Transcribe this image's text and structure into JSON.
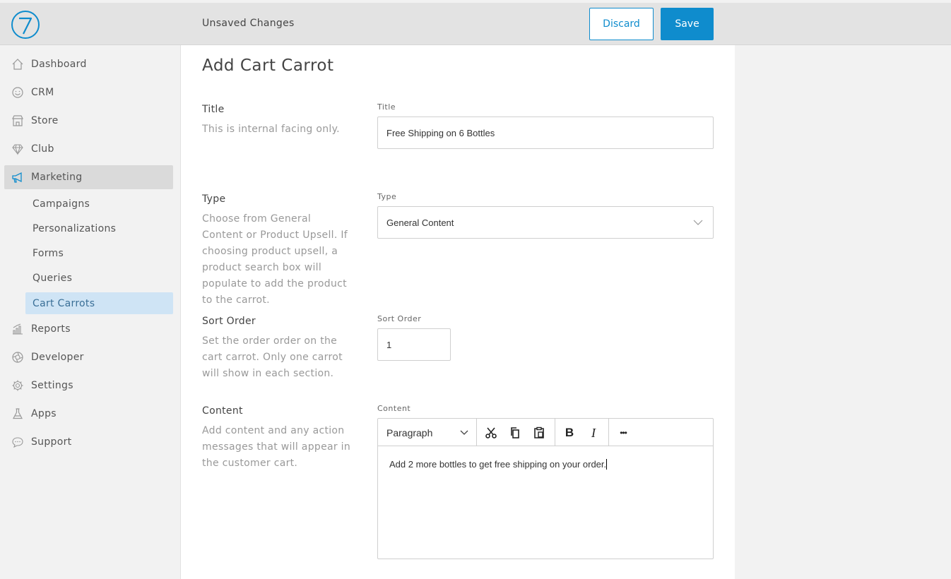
{
  "header": {
    "status_text": "Unsaved Changes",
    "discard_label": "Discard",
    "save_label": "Save",
    "logo_glyph": "7"
  },
  "colors": {
    "accent": "#0f8ccd",
    "active_nav_bg": "#dadada",
    "active_sub_bg": "#cfe4f5"
  },
  "sidebar": {
    "items": [
      {
        "label": "Dashboard",
        "icon": "home-icon"
      },
      {
        "label": "CRM",
        "icon": "smiley-icon"
      },
      {
        "label": "Store",
        "icon": "storefront-icon"
      },
      {
        "label": "Club",
        "icon": "diamond-icon"
      },
      {
        "label": "Marketing",
        "icon": "megaphone-icon",
        "active": true
      },
      {
        "label": "Reports",
        "icon": "bar-chart-icon"
      },
      {
        "label": "Developer",
        "icon": "aperture-icon"
      },
      {
        "label": "Settings",
        "icon": "gear-icon"
      },
      {
        "label": "Apps",
        "icon": "flask-icon"
      },
      {
        "label": "Support",
        "icon": "chat-bubble-icon"
      }
    ],
    "marketing_sub": [
      {
        "label": "Campaigns"
      },
      {
        "label": "Personalizations"
      },
      {
        "label": "Forms"
      },
      {
        "label": "Queries"
      },
      {
        "label": "Cart Carrots",
        "active": true
      }
    ]
  },
  "main": {
    "page_title": "Add Cart Carrot",
    "sections": {
      "title": {
        "heading": "Title",
        "description": "This is internal facing only.",
        "field_label": "Title",
        "value": "Free Shipping on 6 Bottles"
      },
      "type": {
        "heading": "Type",
        "description": "Choose from General Content or Product Upsell. If choosing product upsell, a product search box will populate to add the product to the carrot.",
        "field_label": "Type",
        "value": "General Content"
      },
      "sort_order": {
        "heading": "Sort Order",
        "description": "Set the order order on the cart carrot. Only one carrot will show in each section.",
        "field_label": "Sort Order",
        "value": "1"
      },
      "content": {
        "heading": "Content",
        "description": "Add content and any action messages that will appear in the customer cart.",
        "field_label": "Content",
        "format_select": "Paragraph",
        "bold_label": "B",
        "italic_label": "I",
        "more_label": "•••",
        "body": "Add 2 more bottles to get free shipping on your order."
      }
    }
  }
}
